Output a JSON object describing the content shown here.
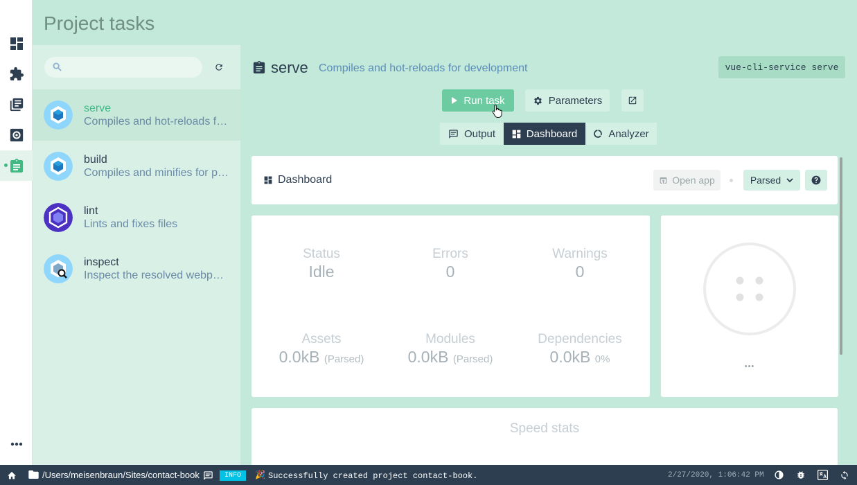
{
  "header": {
    "title": "Project tasks"
  },
  "search": {
    "placeholder": ""
  },
  "tasks": [
    {
      "name": "serve",
      "desc": "Compiles and hot-reloads for development",
      "selected": true
    },
    {
      "name": "build",
      "desc": "Compiles and minifies for production"
    },
    {
      "name": "lint",
      "desc": "Lints and fixes files"
    },
    {
      "name": "inspect",
      "desc": "Inspect the resolved webpack config"
    }
  ],
  "task_header": {
    "name": "serve",
    "desc": "Compiles and hot-reloads for development",
    "command": "vue-cli-service serve"
  },
  "actions": {
    "run": "Run task",
    "parameters": "Parameters"
  },
  "tabs": [
    {
      "label": "Output"
    },
    {
      "label": "Dashboard",
      "active": true
    },
    {
      "label": "Analyzer"
    }
  ],
  "dashboard": {
    "title": "Dashboard",
    "open_app": "Open app",
    "size_mode": "Parsed"
  },
  "stats": {
    "status": {
      "label": "Status",
      "value": "Idle"
    },
    "errors": {
      "label": "Errors",
      "value": "0"
    },
    "warnings": {
      "label": "Warnings",
      "value": "0"
    },
    "assets": {
      "label": "Assets",
      "value": "0.0kB",
      "suffix": "(Parsed)"
    },
    "modules": {
      "label": "Modules",
      "value": "0.0kB",
      "suffix": "(Parsed)"
    },
    "dependencies": {
      "label": "Dependencies",
      "value": "0.0kB",
      "suffix": "0%"
    }
  },
  "circle": {
    "more": "•••"
  },
  "speed": {
    "title": "Speed stats"
  },
  "statusbar": {
    "path": "/Users/meisenbraun/Sites/contact-book",
    "level": "INFO",
    "message": "Successfully created project contact-book.",
    "time": "2/27/2020, 1:06:42 PM"
  },
  "colors": {
    "accent": "#42b983",
    "dark": "#2c3e50",
    "mint": "#c2e9d9"
  }
}
